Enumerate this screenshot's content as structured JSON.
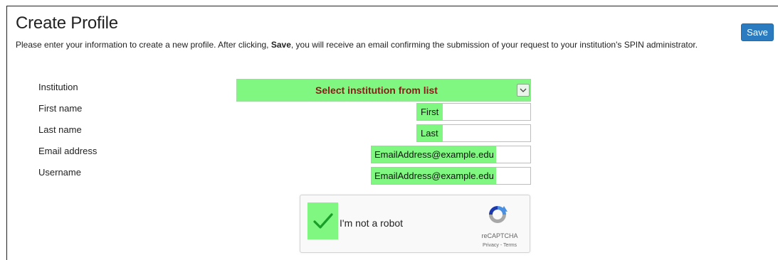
{
  "page": {
    "title": "Create Profile",
    "intro_pre": "Please enter your information to create a new profile. After clicking, ",
    "intro_bold": "Save",
    "intro_post": ", you will receive an email confirming the submission of your request to your institution's SPIN administrator."
  },
  "toolbar": {
    "save_label": "Save"
  },
  "form": {
    "institution": {
      "label": "Institution",
      "value": "Select institution from list"
    },
    "first_name": {
      "label": "First name",
      "value": "First"
    },
    "last_name": {
      "label": "Last name",
      "value": "Last"
    },
    "email": {
      "label": "Email address",
      "value": "EmailAddress@example.edu"
    },
    "username": {
      "label": "Username",
      "value": "EmailAddress@example.edu"
    }
  },
  "captcha": {
    "label": "I'm not a robot",
    "brand": "reCAPTCHA",
    "privacy": "Privacy",
    "separator": " - ",
    "terms": "Terms",
    "checked": true,
    "icon": "recaptcha-logo"
  },
  "colors": {
    "highlight": "#80f780",
    "save_button": "#2a7bbf",
    "select_text": "#8b1a1a",
    "check": "#1a9e2a"
  }
}
